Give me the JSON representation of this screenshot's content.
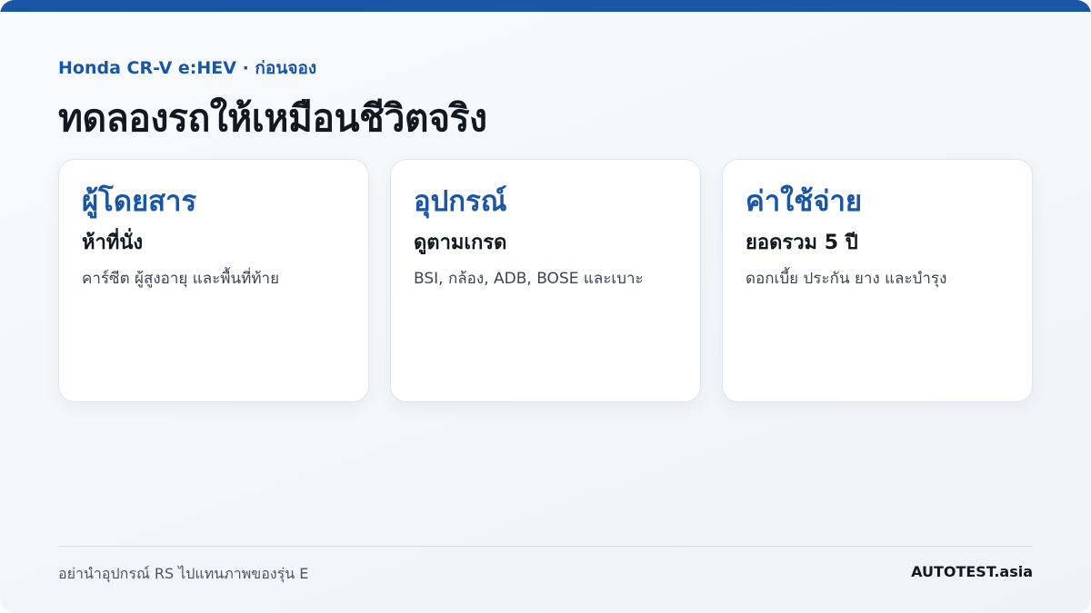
{
  "header": {
    "eyebrow": "Honda CR-V e:HEV · ก่อนจอง",
    "headline": "ทดลองรถให้เหมือนชีวิตจริง"
  },
  "cards": [
    {
      "title": "ผู้โดยสาร",
      "subtitle": "ห้าที่นั่ง",
      "description": "คาร์ซีต ผู้สูงอายุ และพื้นที่ท้าย"
    },
    {
      "title": "อุปกรณ์",
      "subtitle": "ดูตามเกรด",
      "description": "BSI, กล้อง, ADB, BOSE และเบาะ"
    },
    {
      "title": "ค่าใช้จ่าย",
      "subtitle": "ยอดรวม 5 ปี",
      "description": "ดอกเบี้ย ประกัน ยาง และบำรุง"
    }
  ],
  "footer": {
    "note": "อย่านำอุปกรณ์ RS ไปแทนภาพของรุ่น E",
    "brand": "AUTOTEST.asia"
  },
  "colors": {
    "accent": "#1a56a6",
    "heading": "#121820",
    "body_text": "#3a4654",
    "card_background": "#ffffff"
  }
}
